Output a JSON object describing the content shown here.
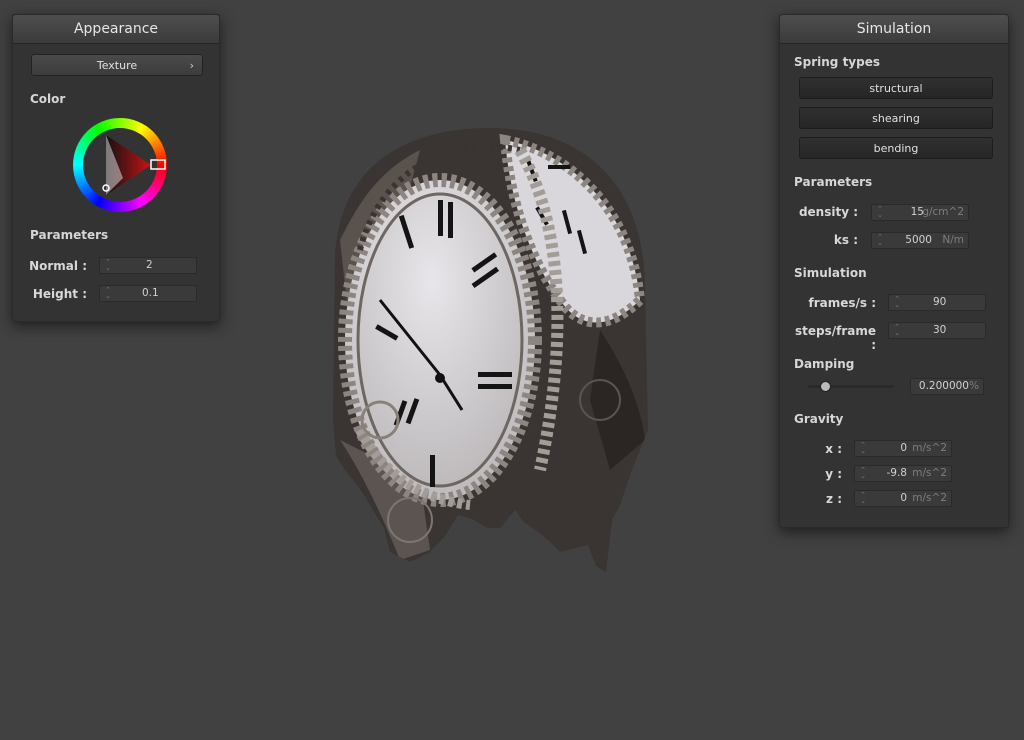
{
  "appearance": {
    "title": "Appearance",
    "texture_button": "Texture",
    "color_label": "Color",
    "parameters_label": "Parameters",
    "normal_label": "Normal :",
    "normal_value": "2",
    "height_label": "Height :",
    "height_value": "0.1"
  },
  "simulation": {
    "title": "Simulation",
    "spring_types_label": "Spring types",
    "spring_buttons": [
      "structural",
      "shearing",
      "bending"
    ],
    "parameters_label": "Parameters",
    "density_label": "density :",
    "density_value": "15",
    "density_unit": "g/cm^2",
    "ks_label": "ks :",
    "ks_value": "5000",
    "ks_unit": "N/m",
    "simulation_label": "Simulation",
    "fps_label": "frames/s :",
    "fps_value": "90",
    "steps_label": "steps/frame :",
    "steps_value": "30",
    "damping_label": "Damping",
    "damping_slider_fraction": 0.2,
    "damping_value": "0.200000",
    "damping_unit": "%",
    "gravity_label": "Gravity",
    "gx_label": "x :",
    "gx_value": "0",
    "gy_label": "y :",
    "gy_value": "-9.8",
    "gz_label": "z :",
    "gz_value": "0",
    "gravity_unit": "m/s^2"
  },
  "colors": {
    "background": "#414141",
    "panel": "#333333",
    "selected_color": "#c81414"
  }
}
